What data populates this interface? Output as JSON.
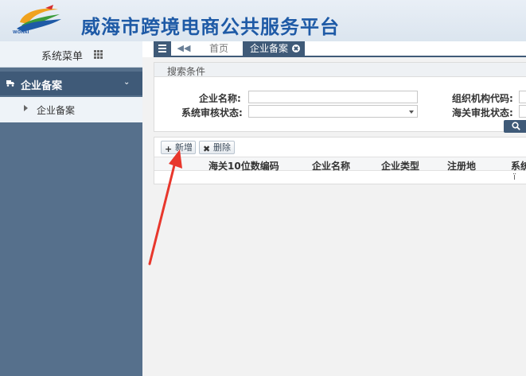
{
  "header": {
    "logo_text": "WOHAI",
    "title": "威海市跨境电商公共服务平台"
  },
  "sidebar": {
    "head_label": "系统菜单",
    "group_label": "企业备案",
    "items": [
      {
        "label": "企业备案"
      }
    ]
  },
  "tabs": {
    "home": "首页",
    "active": "企业备案"
  },
  "search": {
    "title": "搜索条件",
    "company_name_label": "企业名称:",
    "company_name_value": "",
    "org_code_label": "组织机构代码:",
    "org_code_value": "",
    "audit_status_label": "系统审核状态:",
    "audit_status_value": "",
    "customs_status_label": "海关审批状态:",
    "customs_status_value": ""
  },
  "grid": {
    "add_label": "新增",
    "delete_label": "删除",
    "columns": [
      "海关10位数编码",
      "企业名称",
      "企业类型",
      "注册地",
      "系统"
    ],
    "empty_text": "ï"
  },
  "colors": {
    "header_blue": "#1e5aa6",
    "sidebar_bg": "#56708c",
    "active_bg": "#3f5a78",
    "arrow_red": "#e8372c"
  },
  "icons": {
    "menu": "hamburger-icon",
    "back": "double-chevron-left-icon",
    "close": "close-circle-icon",
    "grid": "grid-icon",
    "truck": "truck-icon",
    "search": "search-icon",
    "add": "plus-icon",
    "delete": "x-icon"
  }
}
